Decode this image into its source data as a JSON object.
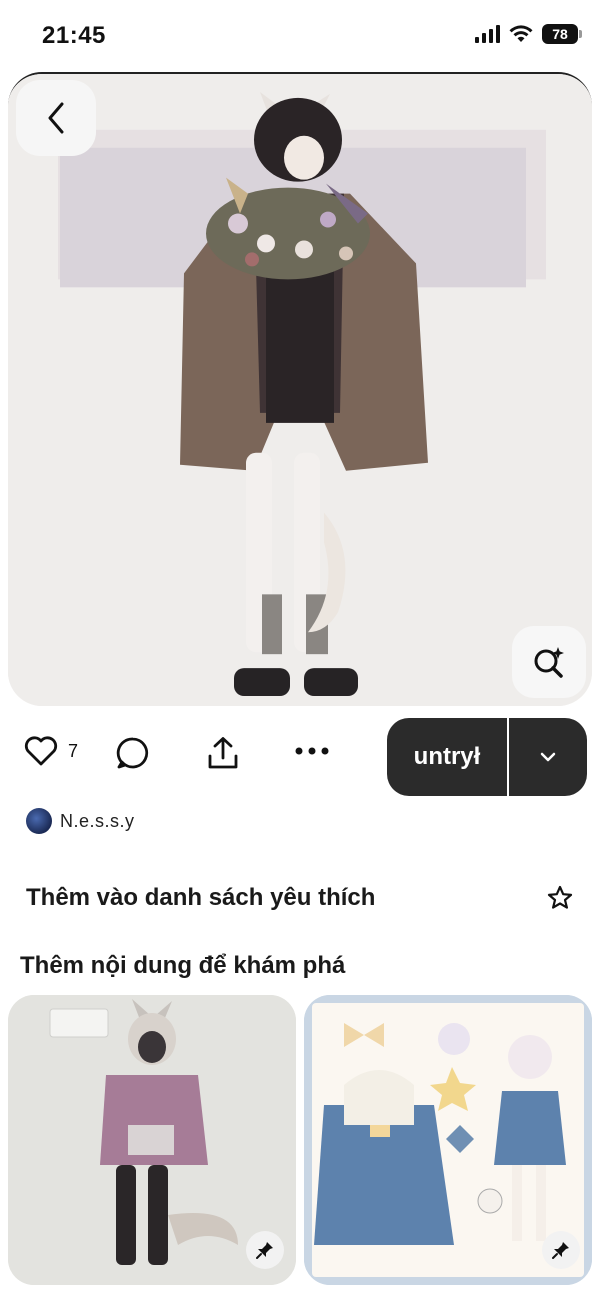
{
  "status_bar": {
    "time": "21:45",
    "battery": "78"
  },
  "pin": {
    "like_count": "7",
    "save_label": "untrył"
  },
  "author": {
    "name": "N.e.s.s.y"
  },
  "favorites": {
    "label": "Thêm vào danh sách yêu thích"
  },
  "explore": {
    "title": "Thêm nội dung để khám phá"
  },
  "icons": {
    "back": "chevron-left-icon",
    "visual_search": "visual-search-sparkle-icon",
    "like": "heart-outline-icon",
    "comment": "comment-bubble-icon",
    "share": "share-upload-icon",
    "more": "more-dots-icon",
    "dropdown": "chevron-down-icon",
    "star": "star-outline-icon",
    "pin": "pushpin-icon"
  },
  "colors": {
    "save_button_bg": "#2b2b2b",
    "card_bg": "#efedeb"
  }
}
